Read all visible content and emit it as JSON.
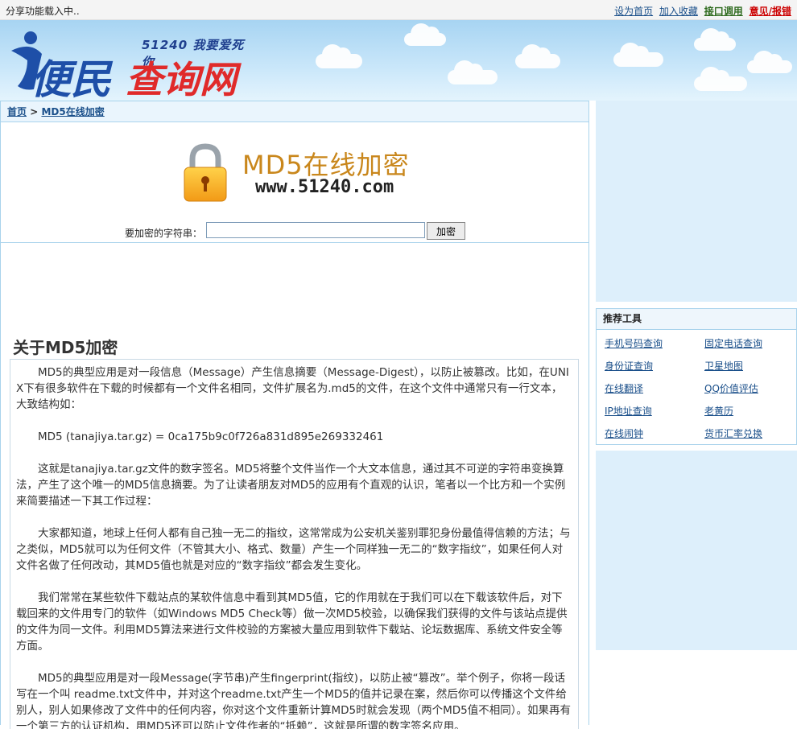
{
  "topbar": {
    "share": "分享功能载入中..",
    "links": [
      "设为首页",
      "加入收藏",
      "接口调用",
      "意见/报错"
    ]
  },
  "logo": {
    "tagline": "51240 我要爱死你",
    "brand_left": "便民",
    "brand_right": "查询网"
  },
  "breadcrumb": {
    "home": "首页",
    "sep": ">",
    "current": "MD5在线加密"
  },
  "hero": {
    "title": "MD5在线加密",
    "url": "www.51240.com"
  },
  "form": {
    "label": "要加密的字符串：",
    "value": "",
    "button": "加密"
  },
  "article": {
    "heading": "关于MD5加密",
    "paragraphs": [
      "MD5的典型应用是对一段信息（Message）产生信息摘要（Message-Digest），以防止被篡改。比如，在UNIX下有很多软件在下载的时候都有一个文件名相同，文件扩展名为.md5的文件，在这个文件中通常只有一行文本，大致结构如：",
      "MD5 (tanajiya.tar.gz) = 0ca175b9c0f726a831d895e269332461",
      "这就是tanajiya.tar.gz文件的数字签名。MD5将整个文件当作一个大文本信息，通过其不可逆的字符串变换算法，产生了这个唯一的MD5信息摘要。为了让读者朋友对MD5的应用有个直观的认识，笔者以一个比方和一个实例来简要描述一下其工作过程：",
      "大家都知道，地球上任何人都有自己独一无二的指纹，这常常成为公安机关鉴别罪犯身份最值得信赖的方法；与之类似，MD5就可以为任何文件（不管其大小、格式、数量）产生一个同样独一无二的“数字指纹”，如果任何人对文件名做了任何改动，其MD5值也就是对应的“数字指纹”都会发生变化。",
      "我们常常在某些软件下载站点的某软件信息中看到其MD5值，它的作用就在于我们可以在下载该软件后，对下载回来的文件用专门的软件（如Windows MD5 Check等）做一次MD5校验，以确保我们获得的文件与该站点提供的文件为同一文件。利用MD5算法来进行文件校验的方案被大量应用到软件下载站、论坛数据库、系统文件安全等方面。",
      "MD5的典型应用是对一段Message(字节串)产生fingerprint(指纹)，以防止被“篡改”。举个例子，你将一段话写在一个叫 readme.txt文件中，并对这个readme.txt产生一个MD5的值并记录在案，然后你可以传播这个文件给别人，别人如果修改了文件中的任何内容，你对这个文件重新计算MD5时就会发现（两个MD5值不相同）。如果再有一个第三方的认证机构，用MD5还可以防止文件作者的“抵赖”，这就是所谓的数字签名应用。"
    ]
  },
  "sidebar": {
    "title": "推荐工具",
    "tools": [
      "手机号码查询",
      "固定电话查询",
      "身份证查询",
      "卫星地图",
      "在线翻译",
      "QQ价值评估",
      "IP地址查询",
      "老黄历",
      "在线闹钟",
      "货币汇率兑换"
    ]
  },
  "colors": {
    "link": "#1a4f8a",
    "border": "#a9d3ec",
    "panel_bg": "#ddeffb",
    "brand_blue": "#1e4fa8",
    "brand_red": "#e02a2a"
  }
}
